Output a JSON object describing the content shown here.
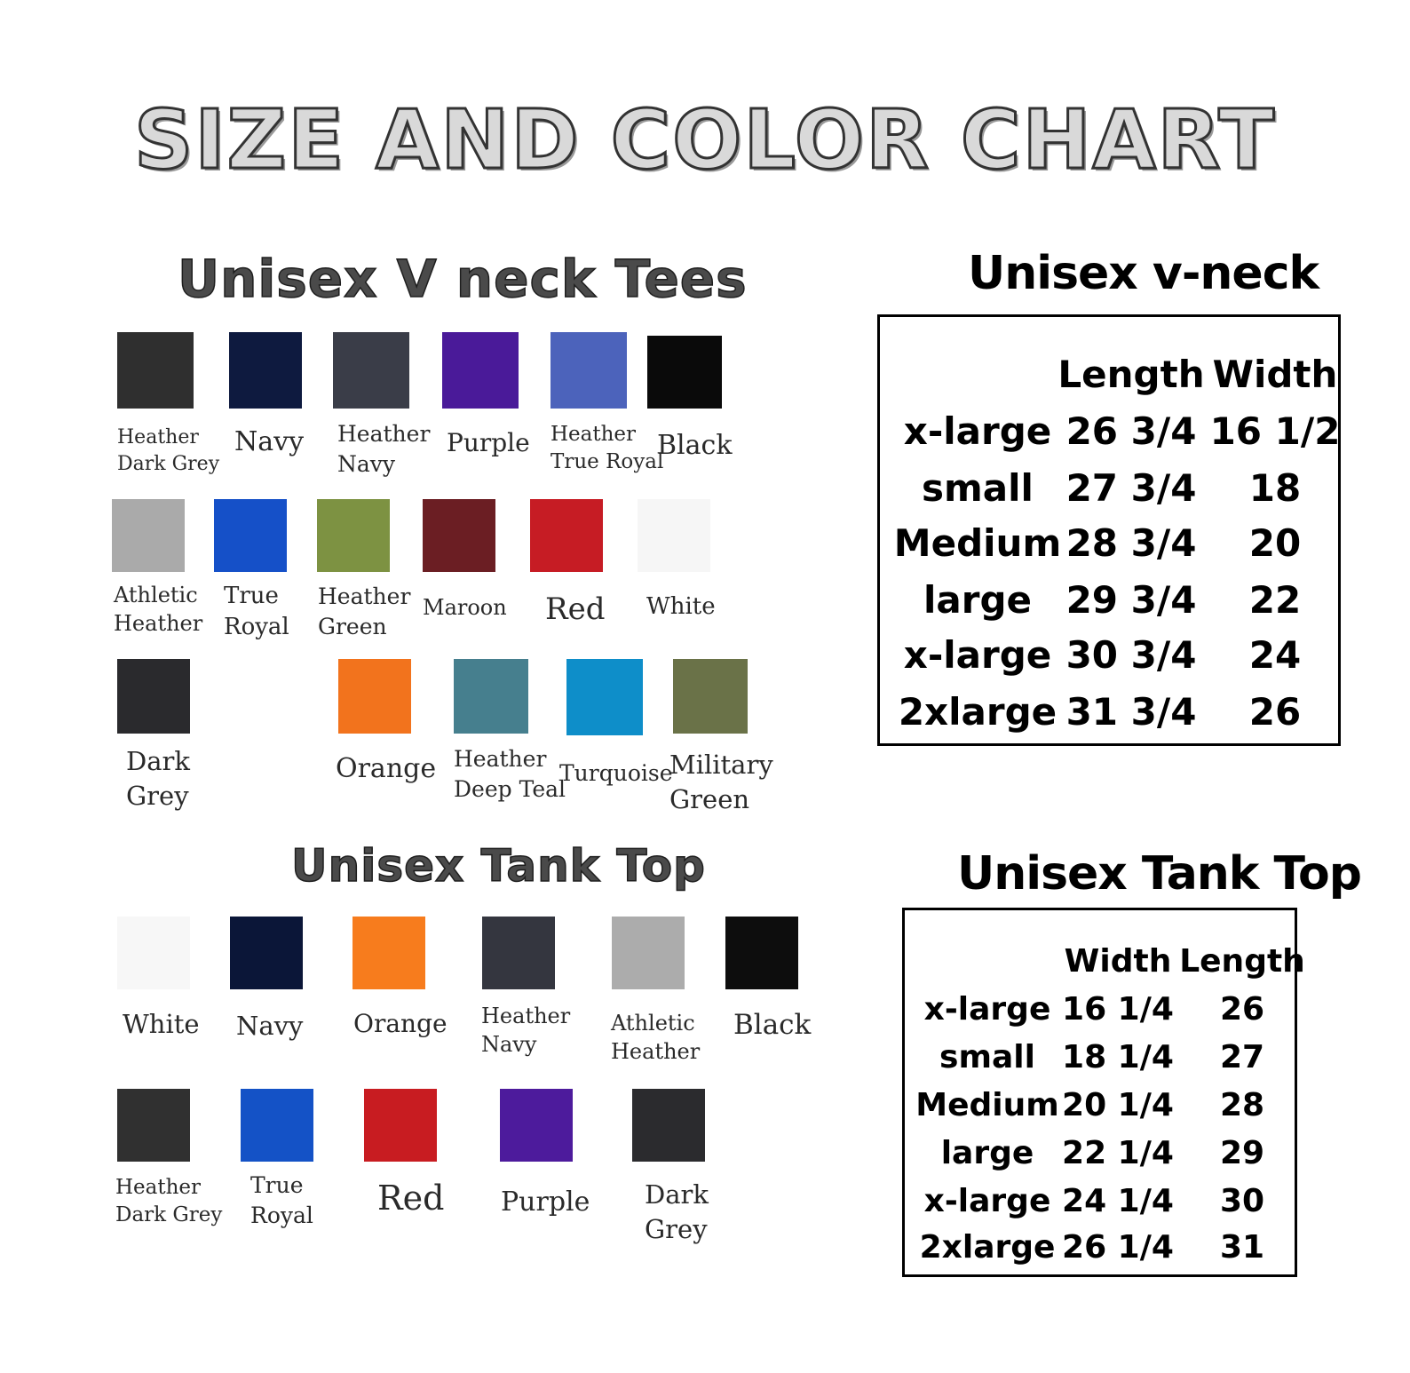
{
  "title": "SIZE AND COLOR CHART",
  "vneck_colors": {
    "title": "Unisex V neck Tees",
    "swatches": [
      {
        "lines": [
          "Heather",
          "Dark Grey"
        ],
        "color": "#2f2f2f"
      },
      {
        "lines": [
          "Navy"
        ],
        "color": "#0e1a3f"
      },
      {
        "lines": [
          "Heather",
          "Navy"
        ],
        "color": "#3a3d48"
      },
      {
        "lines": [
          "Purple"
        ],
        "color": "#4a1a99"
      },
      {
        "lines": [
          "Heather",
          "True Royal"
        ],
        "color": "#4c63bb"
      },
      {
        "lines": [
          "Black"
        ],
        "color": "#0a0a0a"
      },
      {
        "lines": [
          "Athletic",
          "Heather"
        ],
        "color": "#aaaaaa"
      },
      {
        "lines": [
          "True",
          "Royal"
        ],
        "color": "#1550c8"
      },
      {
        "lines": [
          "Heather",
          "Green"
        ],
        "color": "#7d9242"
      },
      {
        "lines": [
          "Maroon"
        ],
        "color": "#6b1e23"
      },
      {
        "lines": [
          "Red"
        ],
        "color": "#c61c24"
      },
      {
        "lines": [
          "White"
        ],
        "color": "#f6f6f6"
      },
      {
        "lines": [
          "Dark",
          "Grey"
        ],
        "color": "#2a2a2d"
      },
      {
        "lines": [
          "Orange"
        ],
        "color": "#f2731d"
      },
      {
        "lines": [
          "Heather",
          "Deep Teal"
        ],
        "color": "#467f8e"
      },
      {
        "lines": [
          "Turquoise"
        ],
        "color": "#0e8ec9"
      },
      {
        "lines": [
          "Military",
          "Green"
        ],
        "color": "#6a7248"
      }
    ]
  },
  "tank_colors": {
    "title": "Unisex Tank Top",
    "swatches": [
      {
        "lines": [
          "White"
        ],
        "color": "#f7f7f7"
      },
      {
        "lines": [
          "Navy"
        ],
        "color": "#0b1638"
      },
      {
        "lines": [
          "Orange"
        ],
        "color": "#f77c1d"
      },
      {
        "lines": [
          "Heather",
          "Navy"
        ],
        "color": "#34363f"
      },
      {
        "lines": [
          "Athletic",
          "Heather"
        ],
        "color": "#acacac"
      },
      {
        "lines": [
          "Black"
        ],
        "color": "#0d0d0d"
      },
      {
        "lines": [
          "Heather",
          "Dark Grey"
        ],
        "color": "#303030"
      },
      {
        "lines": [
          "True",
          "Royal"
        ],
        "color": "#1452c6"
      },
      {
        "lines": [
          "Red"
        ],
        "color": "#c81c21"
      },
      {
        "lines": [
          "Purple"
        ],
        "color": "#4d1b9c"
      },
      {
        "lines": [
          "Dark",
          "Grey"
        ],
        "color": "#2b2b2e"
      }
    ]
  },
  "vneck_sizes": {
    "title": "Unisex v-neck",
    "headers": [
      "",
      "Length",
      "Width"
    ],
    "rows": [
      [
        "x-large",
        "26 3/4",
        "16 1/2"
      ],
      [
        "small",
        "27 3/4",
        "18"
      ],
      [
        "Medium",
        "28 3/4",
        "20"
      ],
      [
        "large",
        "29 3/4",
        "22"
      ],
      [
        "x-large",
        "30 3/4",
        "24"
      ],
      [
        "2xlarge",
        "31 3/4",
        "26"
      ]
    ]
  },
  "tank_sizes": {
    "title": "Unisex Tank Top",
    "headers": [
      "",
      "Width",
      "Length"
    ],
    "rows": [
      [
        "x-large",
        "16 1/4",
        "26"
      ],
      [
        "small",
        "18 1/4",
        "27"
      ],
      [
        "Medium",
        "20 1/4",
        "28"
      ],
      [
        "large",
        "22 1/4",
        "29"
      ],
      [
        "x-large",
        "24 1/4",
        "30"
      ],
      [
        "2xlarge",
        "26 1/4",
        "31"
      ]
    ]
  }
}
